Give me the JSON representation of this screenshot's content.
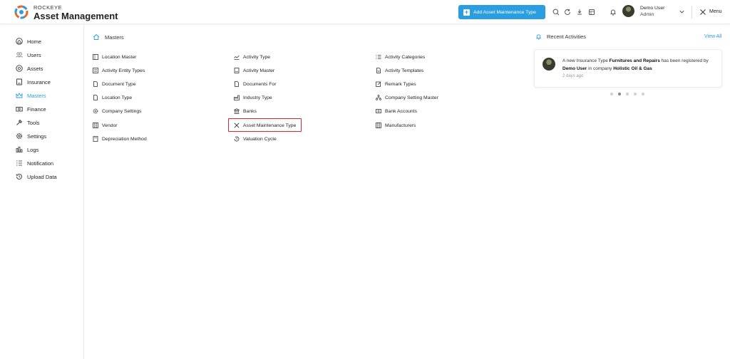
{
  "brand": {
    "top": "ROCKEYE",
    "main": "Asset Management"
  },
  "header": {
    "add_button_label": "Add Asset Maintenance Type",
    "user_name": "Demo User",
    "user_role": "Admin",
    "menu_label": "Menu"
  },
  "sidebar": {
    "items": [
      {
        "label": "Home",
        "icon": "home-icon"
      },
      {
        "label": "Users",
        "icon": "users-icon"
      },
      {
        "label": "Assets",
        "icon": "assets-icon"
      },
      {
        "label": "Insurance",
        "icon": "insurance-icon"
      },
      {
        "label": "Masters",
        "icon": "crown-icon",
        "active": true
      },
      {
        "label": "Finance",
        "icon": "finance-icon"
      },
      {
        "label": "Tools",
        "icon": "tools-icon"
      },
      {
        "label": "Settings",
        "icon": "gear-icon"
      },
      {
        "label": "Logs",
        "icon": "logs-icon"
      },
      {
        "label": "Notification",
        "icon": "list-icon"
      },
      {
        "label": "Upload Data",
        "icon": "history-icon"
      }
    ]
  },
  "main": {
    "title": "Masters",
    "col1": [
      "Location Master",
      "Activity Entity Types",
      "Document Type",
      "Location Type",
      "Company Settings",
      "Vendor",
      "Depreciation Method"
    ],
    "col2": [
      "Activity Type",
      "Activity Master",
      "Documents For",
      "Industry Type",
      "Banks",
      "Asset Maintenance Type",
      "Valuation Cycle"
    ],
    "col3": [
      "Activity Categories",
      "Activity Templates",
      "Remark Types",
      "Company Setting Master",
      "Bank Accounts",
      "Manufacturers"
    ]
  },
  "recent": {
    "title": "Recent Activities",
    "view_all": "View All",
    "card": {
      "prefix": "A new Insurance Type ",
      "bold1": "Furnitures and Repairs",
      "mid": " has been registered by",
      "bold2": "Demo User",
      "mid2": " in company ",
      "bold3": "Holistic Oil & Gas",
      "time": "2 days ago"
    },
    "dots_active_index": 1,
    "dots_count": 5
  },
  "colors": {
    "accent": "#2a9ee0",
    "highlight": "#e0262c"
  }
}
